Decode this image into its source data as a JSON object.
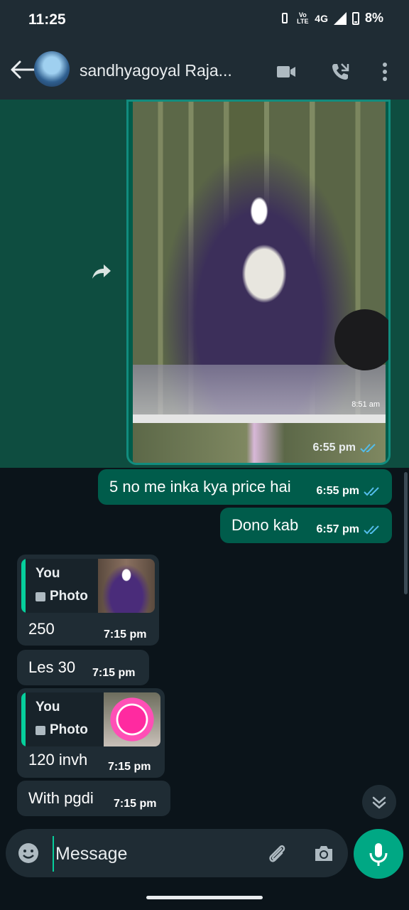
{
  "status_bar": {
    "time": "11:25",
    "network": "4G",
    "battery": "8%",
    "volte": "Vo LTE"
  },
  "header": {
    "contact_name": "sandhyagoyal Raja..."
  },
  "image_message": {
    "photo_timestamp": "8:51 am",
    "time": "6:55 pm"
  },
  "messages": [
    {
      "dir": "out",
      "text": "5 no me inka kya price hai",
      "time": "6:55 pm"
    },
    {
      "dir": "out",
      "text": "Dono kab",
      "time": "6:57 pm"
    },
    {
      "dir": "in",
      "quote_author": "You",
      "quote_label": "Photo",
      "text": "250",
      "time": "7:15 pm"
    },
    {
      "dir": "in",
      "text": "Les 30",
      "time": "7:15 pm"
    },
    {
      "dir": "in",
      "quote_author": "You",
      "quote_label": "Photo",
      "text": "120 invh",
      "time": "7:15 pm"
    },
    {
      "dir": "in",
      "text": "With pgdi",
      "time": "7:15 pm"
    }
  ],
  "input": {
    "placeholder": "Message"
  },
  "colors": {
    "outgoing": "#005c4b",
    "incoming": "#1f2c34",
    "accent": "#00a884",
    "read_ticks": "#53bdeb"
  },
  "icons": [
    "back-arrow-icon",
    "video-call-icon",
    "voice-call-icon",
    "more-options-icon",
    "forward-icon",
    "scroll-down-icon",
    "emoji-icon",
    "attach-icon",
    "camera-icon",
    "mic-icon"
  ]
}
